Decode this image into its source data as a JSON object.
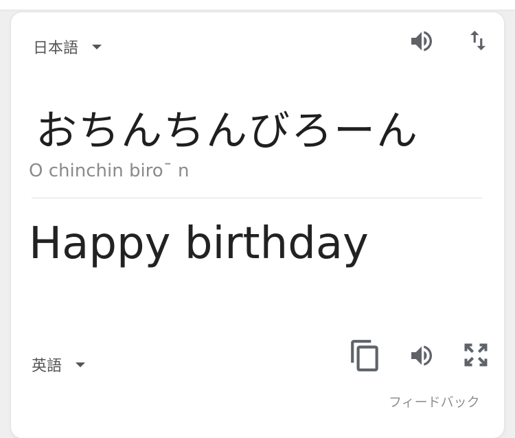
{
  "source": {
    "language": "日本語",
    "text": "おちんちんびろーん",
    "romanization": "O chinchin biro¯ n"
  },
  "target": {
    "language": "英語",
    "text": "Happy birthday"
  },
  "icons": {
    "listen_source": "speaker-icon",
    "swap": "swap-arrows-icon",
    "copy": "copy-icon",
    "listen_target": "speaker-icon",
    "fullscreen": "fullscreen-icon"
  },
  "feedback_label": "フィードバック",
  "colors": {
    "icon": "#5f6368",
    "text": "#222222",
    "muted": "#8a8a8a"
  }
}
